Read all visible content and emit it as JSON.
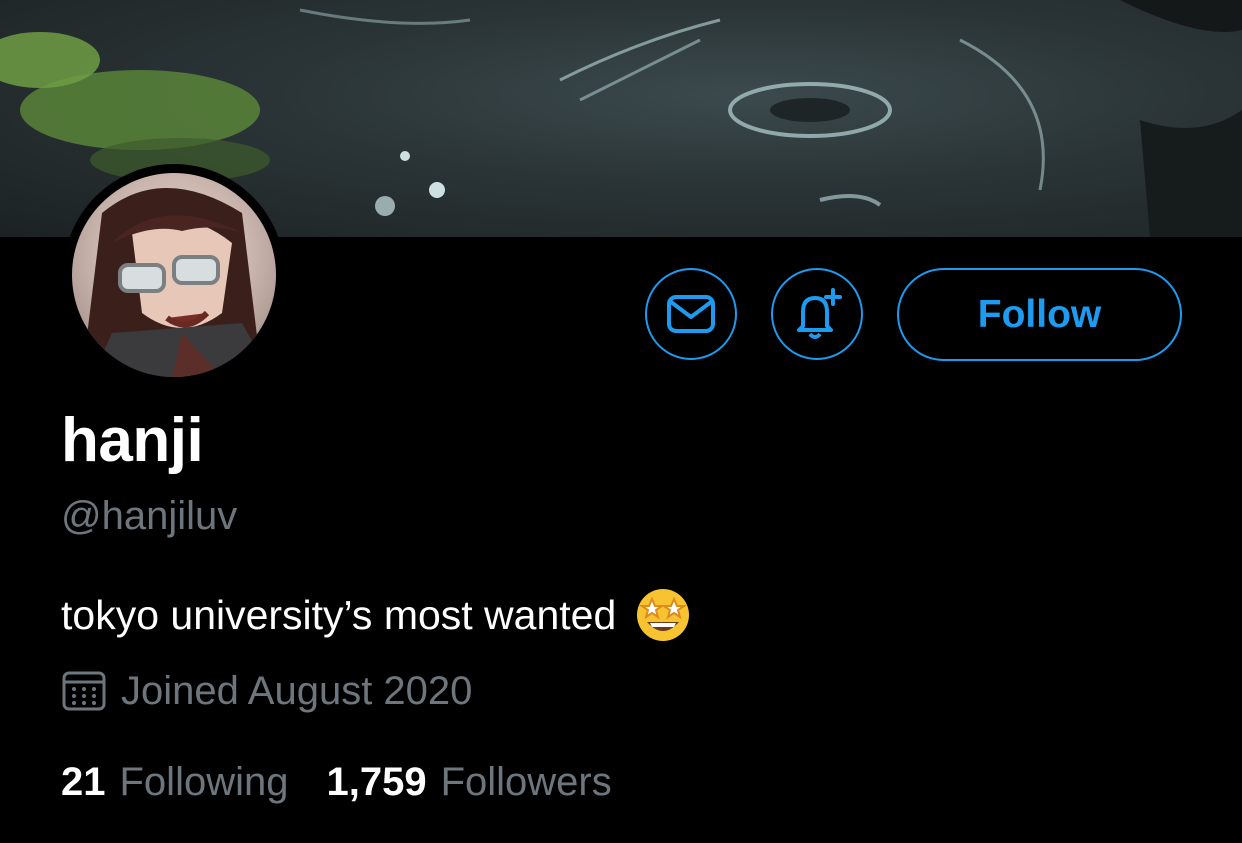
{
  "profile": {
    "display_name": "hanji",
    "handle": "@hanjiluv",
    "bio_text": "tokyo university’s most wanted",
    "bio_emoji": "star-struck-emoji",
    "joined": "Joined August 2020"
  },
  "actions": {
    "follow_label": "Follow",
    "message_icon": "envelope-icon",
    "notify_icon": "bell-plus-icon"
  },
  "stats": {
    "following_count": "21",
    "following_label": "Following",
    "followers_count": "1,759",
    "followers_label": "Followers"
  },
  "colors": {
    "accent": "#1d9bf0",
    "secondary_text": "#6e767d",
    "background": "#000000"
  }
}
